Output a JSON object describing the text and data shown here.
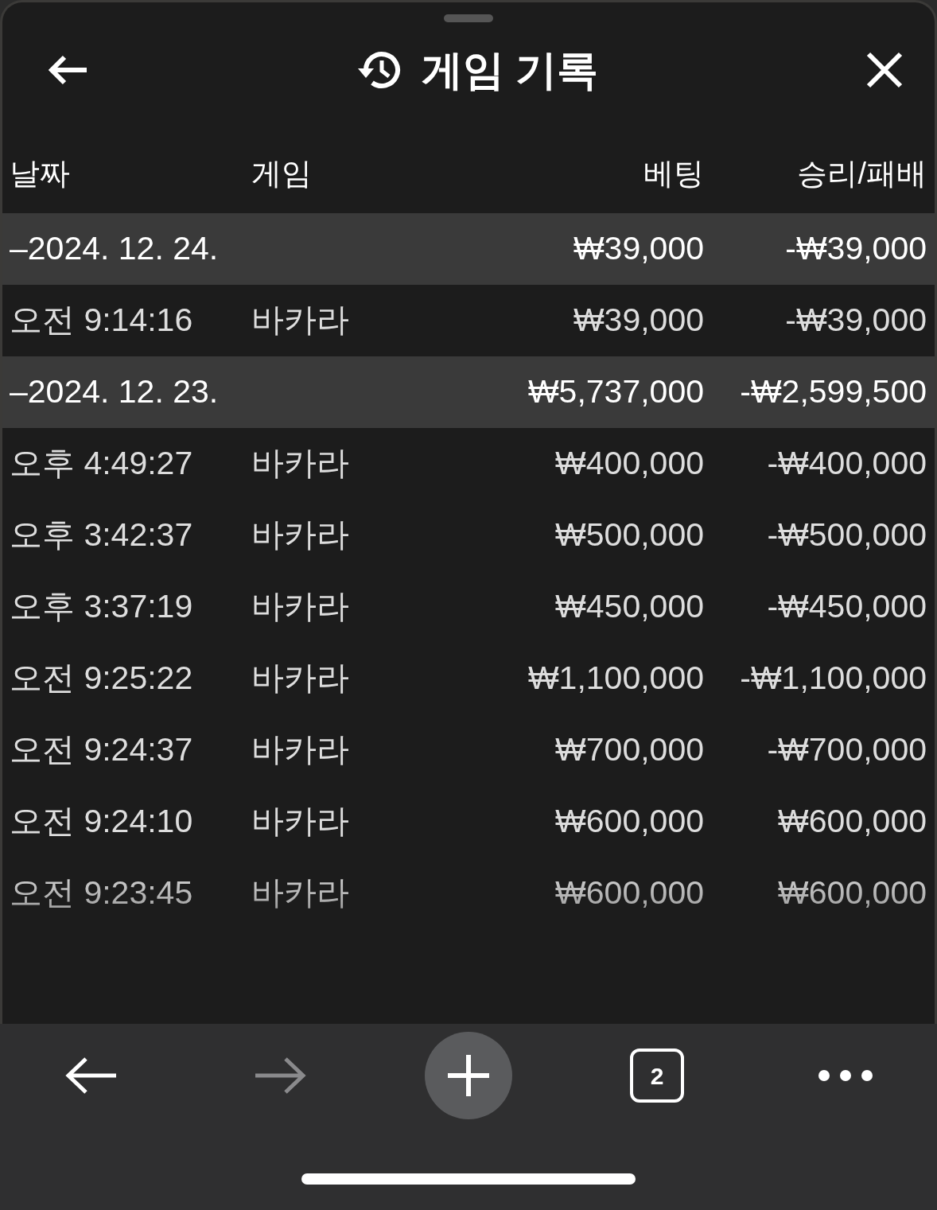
{
  "header": {
    "title": "게임 기록"
  },
  "columns": [
    "날짜",
    "게임",
    "베팅",
    "승리/패배"
  ],
  "groups": [
    {
      "date": "–2024. 12. 24.",
      "bet": "₩39,000",
      "result": "-₩39,000",
      "rows": [
        {
          "time": "오전 9:14:16",
          "game": "바카라",
          "bet": "₩39,000",
          "result": "-₩39,000"
        }
      ]
    },
    {
      "date": "–2024. 12. 23.",
      "bet": "₩5,737,000",
      "result": "-₩2,599,500",
      "rows": [
        {
          "time": "오후 4:49:27",
          "game": "바카라",
          "bet": "₩400,000",
          "result": "-₩400,000"
        },
        {
          "time": "오후 3:42:37",
          "game": "바카라",
          "bet": "₩500,000",
          "result": "-₩500,000"
        },
        {
          "time": "오후 3:37:19",
          "game": "바카라",
          "bet": "₩450,000",
          "result": "-₩450,000"
        },
        {
          "time": "오전 9:25:22",
          "game": "바카라",
          "bet": "₩1,100,000",
          "result": "-₩1,100,000"
        },
        {
          "time": "오전 9:24:37",
          "game": "바카라",
          "bet": "₩700,000",
          "result": "-₩700,000"
        },
        {
          "time": "오전 9:24:10",
          "game": "바카라",
          "bet": "₩600,000",
          "result": "₩600,000"
        },
        {
          "time": "오전 9:23:45",
          "game": "바카라",
          "bet": "₩600,000",
          "result": "₩600,000"
        }
      ]
    }
  ],
  "toolbar": [
    {
      "kind": "back",
      "disabled": false
    },
    {
      "kind": "forward",
      "disabled": true
    },
    {
      "kind": "new-tab",
      "disabled": false
    },
    {
      "kind": "tabs",
      "disabled": false,
      "count": "2"
    },
    {
      "kind": "more",
      "disabled": false
    }
  ]
}
